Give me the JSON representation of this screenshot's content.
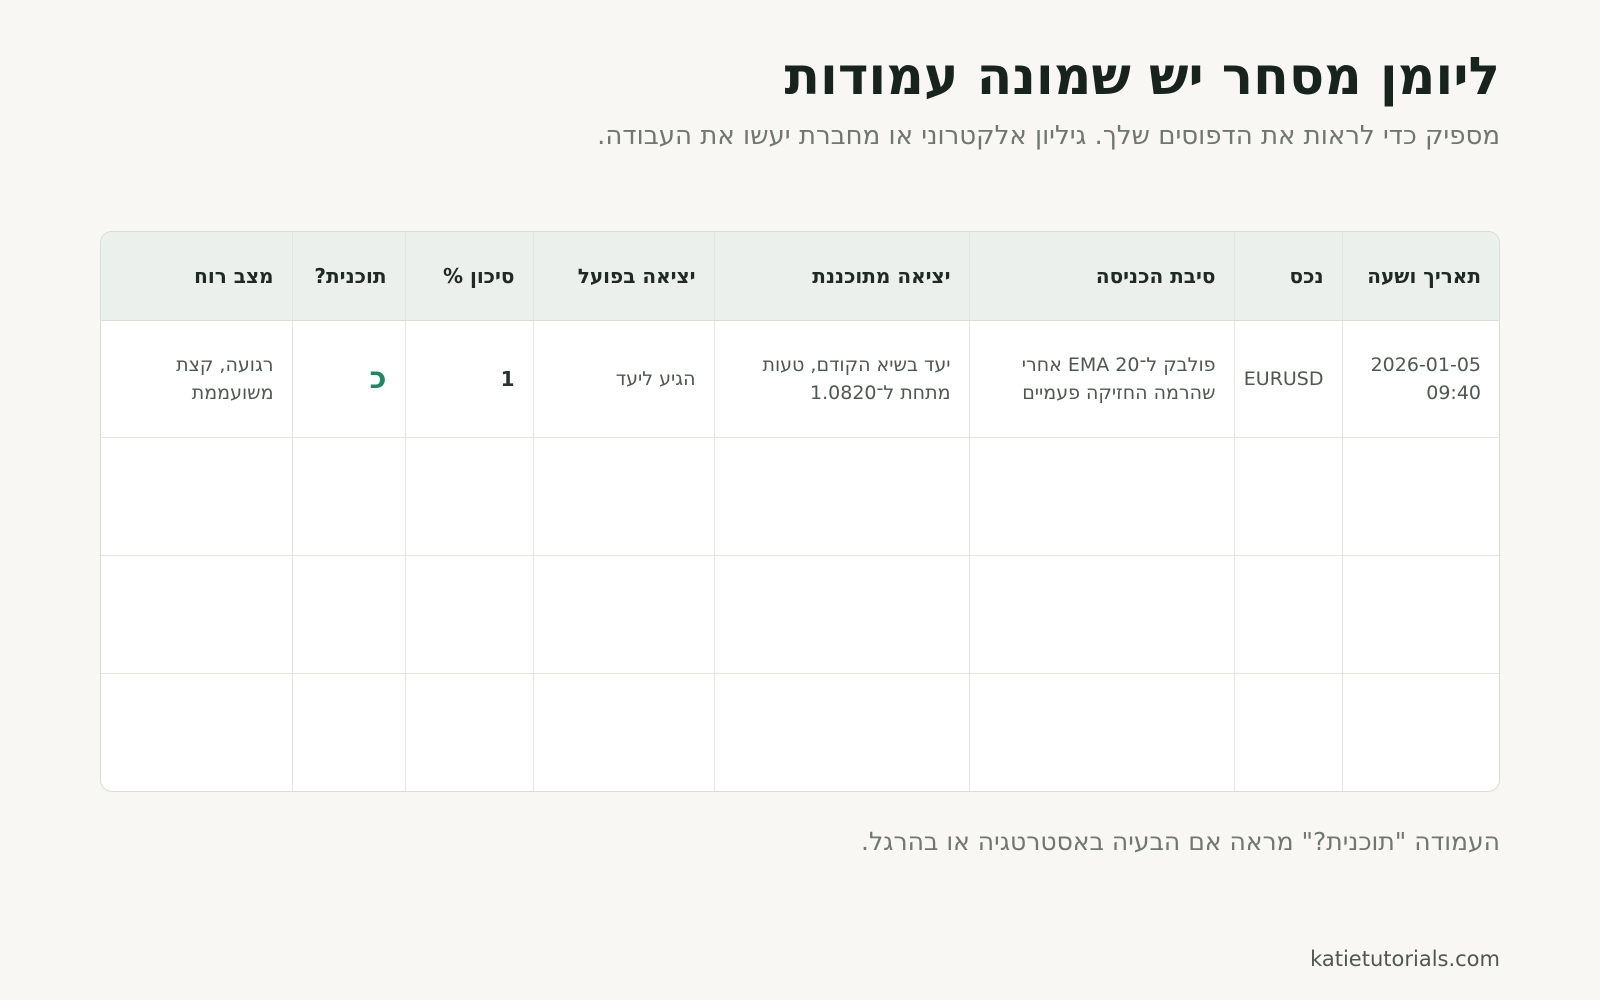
{
  "header": {
    "title": "ליומן מסחר יש שמונה עמודות",
    "subtitle": "מספיק כדי לראות את הדפוסים שלך. גיליון אלקטרוני או מחברת יעשו את העבודה."
  },
  "table": {
    "columns": [
      "תאריך ושעה",
      "נכס",
      "סיבת הכניסה",
      "יציאה מתוכננת",
      "יציאה בפועל",
      "סיכון %",
      "תוכנית?",
      "מצב רוח"
    ],
    "rows": [
      [
        "2026-01-05 09:40",
        "EURUSD",
        "פולבק ל־EMA 20 אחרי שהרמה החזיקה פעמיים",
        "יעד בשיא הקודם, טעות מתחת ל־1.0820",
        "הגיע ליעד",
        "1",
        "כ",
        "רגועה, קצת משועממת"
      ],
      [
        "",
        "",
        "",
        "",
        "",
        "",
        "",
        ""
      ],
      [
        "",
        "",
        "",
        "",
        "",
        "",
        "",
        ""
      ],
      [
        "",
        "",
        "",
        "",
        "",
        "",
        "",
        ""
      ]
    ]
  },
  "note": "העמודה \"תוכנית?\" מראה אם הבעיה באסטרטגיה או בהרגל.",
  "footer": "katietutorials.com",
  "colors": {
    "background": "#f8f7f3",
    "header_row": "#ebf0ec",
    "plan_mark": "#1a8a63"
  }
}
